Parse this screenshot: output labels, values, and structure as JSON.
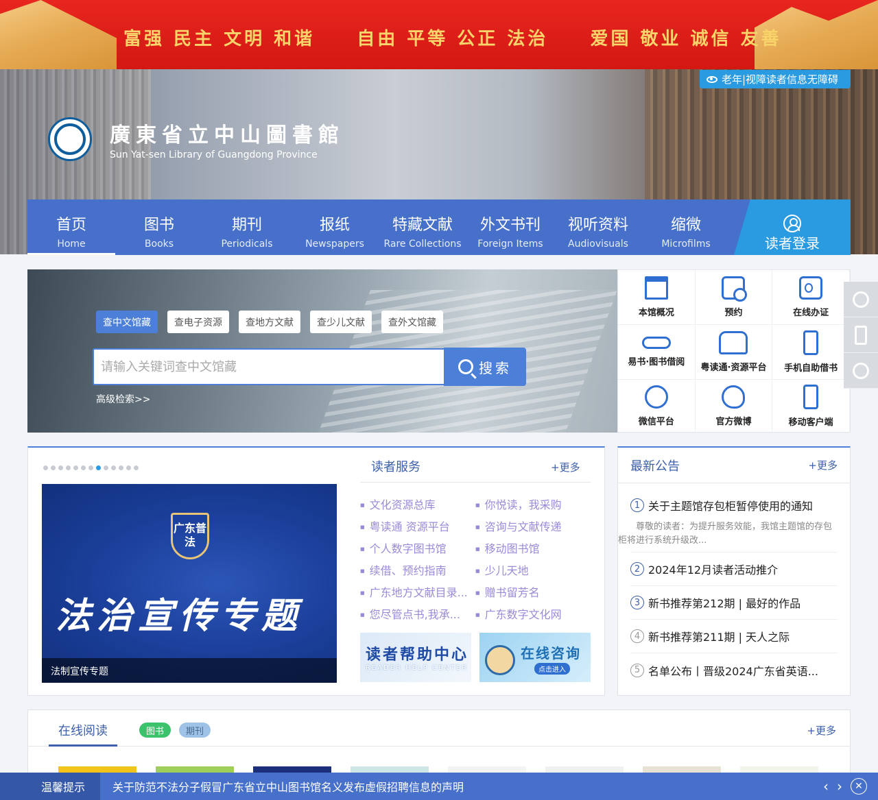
{
  "slogan": {
    "groups": [
      "富强 民主 文明 和谐",
      "自由 平等 公正 法治",
      "爱国 敬业 诚信 友善"
    ]
  },
  "accessibility": {
    "label": "老年|视障读者信息无障碍"
  },
  "logo": {
    "name_cn": "廣東省立中山圖書館",
    "name_en": "Sun Yat-sen Library of Guangdong Province"
  },
  "nav": {
    "items": [
      {
        "cn": "首页",
        "en": "Home"
      },
      {
        "cn": "图书",
        "en": "Books"
      },
      {
        "cn": "期刊",
        "en": "Periodicals"
      },
      {
        "cn": "报纸",
        "en": "Newspapers"
      },
      {
        "cn": "特藏文献",
        "en": "Rare Collections"
      },
      {
        "cn": "外文书刊",
        "en": "Foreign Items"
      },
      {
        "cn": "视听资料",
        "en": "Audiovisuals"
      },
      {
        "cn": "缩微",
        "en": "Microfilms"
      }
    ],
    "login": "读者登录"
  },
  "search": {
    "tabs": [
      "查中文馆藏",
      "查电子资源",
      "查地方文献",
      "查少儿文献",
      "查外文馆藏"
    ],
    "placeholder": "请输入关键词查中文馆藏",
    "button": "搜索",
    "advanced": "高级检索>>"
  },
  "quick": [
    {
      "label": "本馆概况",
      "icon": "library-building-icon"
    },
    {
      "label": "预约",
      "icon": "calendar-clock-icon"
    },
    {
      "label": "在线办证",
      "icon": "id-card-icon"
    },
    {
      "label": "易书·图书借阅",
      "icon": "link-icon"
    },
    {
      "label": "粤读通·资源平台",
      "icon": "open-book-icon"
    },
    {
      "label": "手机自助借书",
      "icon": "mobile-scan-icon"
    },
    {
      "label": "微信平台",
      "icon": "wechat-icon"
    },
    {
      "label": "官方微博",
      "icon": "weibo-icon"
    },
    {
      "label": "移动客户端",
      "icon": "mobile-phone-icon"
    }
  ],
  "slider": {
    "total_dots": 13,
    "active_dot": 7,
    "shield_text": "广东普法",
    "headline": "法治宣传专题",
    "caption": "法制宣传专题"
  },
  "services": {
    "title": "读者服务",
    "more": "+更多",
    "links": [
      "文化资源总库",
      "你悦读，我采购",
      "粤读通 资源平台",
      "咨询与文献传递",
      "个人数字图书馆",
      "移动图书馆",
      "续借、预约指南",
      "少儿天地",
      "广东地方文献目录...",
      "赠书留芳名",
      "您尽管点书,我承...",
      "广东数字文化网"
    ],
    "banner1_title": "读者帮助中心",
    "banner1_sub": "READER HELP CENTER",
    "banner2_title": "在线咨询",
    "banner2_btn": "点击进入"
  },
  "notices": {
    "title": "最新公告",
    "more": "+更多",
    "items": [
      {
        "num": "1",
        "title": "关于主题馆存包柜暂停使用的通知",
        "desc": "尊敬的读者：为提升服务效能，我馆主题馆的存包柜将进行系统升级改..."
      },
      {
        "num": "2",
        "title": "2024年12月读者活动推介"
      },
      {
        "num": "3",
        "title": "新书推荐第212期 | 最好的作品"
      },
      {
        "num": "4",
        "title": "新书推荐第211期 | 天人之际"
      },
      {
        "num": "5",
        "title": "名单公布丨晋级2024广东省英语..."
      }
    ]
  },
  "reading": {
    "title": "在线阅读",
    "pills": [
      "图书",
      "期刊"
    ],
    "more": "+更多",
    "cover_colors": [
      "#f2c318",
      "#9fcf5a",
      "#1b2f7a",
      "#cfe6e6",
      "#f3f3f3",
      "#f0f0f0",
      "#e8e2d4",
      "#f2f4ea"
    ]
  },
  "bottom": {
    "label": "温馨提示",
    "message": "关于防范不法分子假冒广东省立中山图书馆名义发布虚假招聘信息的声明",
    "prev": "‹",
    "next": "›",
    "close": "✕"
  },
  "colors": {
    "brand_blue": "#4670c9",
    "accent_blue": "#2a9be0",
    "slogan_red": "#d31712",
    "slogan_gold": "#f9d46b"
  }
}
